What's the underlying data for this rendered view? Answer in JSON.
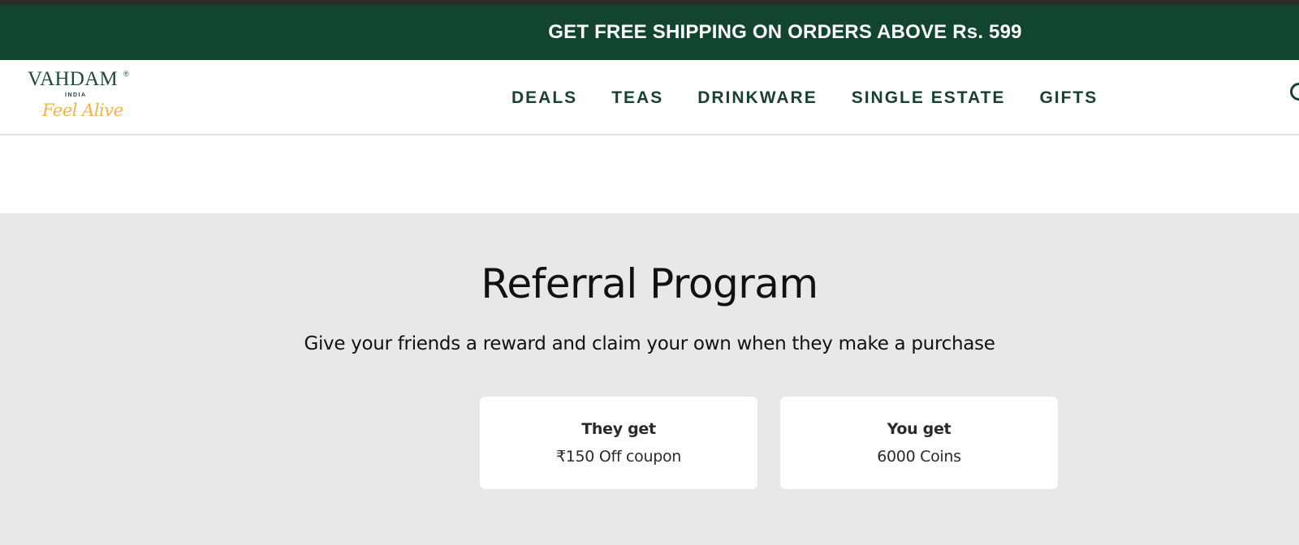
{
  "announcement": {
    "text": "GET FREE SHIPPING ON ORDERS ABOVE Rs. 599"
  },
  "header": {
    "logo": {
      "brand": "VAHDAM",
      "registered": "®",
      "country": "INDIA",
      "tagline": "Feel Alive"
    },
    "nav": [
      {
        "label": "DEALS"
      },
      {
        "label": "TEAS"
      },
      {
        "label": "DRINKWARE"
      },
      {
        "label": "SINGLE ESTATE"
      },
      {
        "label": "GIFTS"
      }
    ],
    "edge_icon": "search-icon"
  },
  "referral": {
    "title": "Referral Program",
    "subtitle": "Give your friends a reward and claim your own when they make a purchase",
    "cards": [
      {
        "title": "They get",
        "value": "₹150 Off coupon"
      },
      {
        "title": "You get",
        "value": "6000 Coins"
      }
    ]
  },
  "colors": {
    "announcement_bg": "#124530",
    "nav_text": "#1a4030",
    "tagline": "#f2b640",
    "section_bg": "#e8e8e8"
  }
}
